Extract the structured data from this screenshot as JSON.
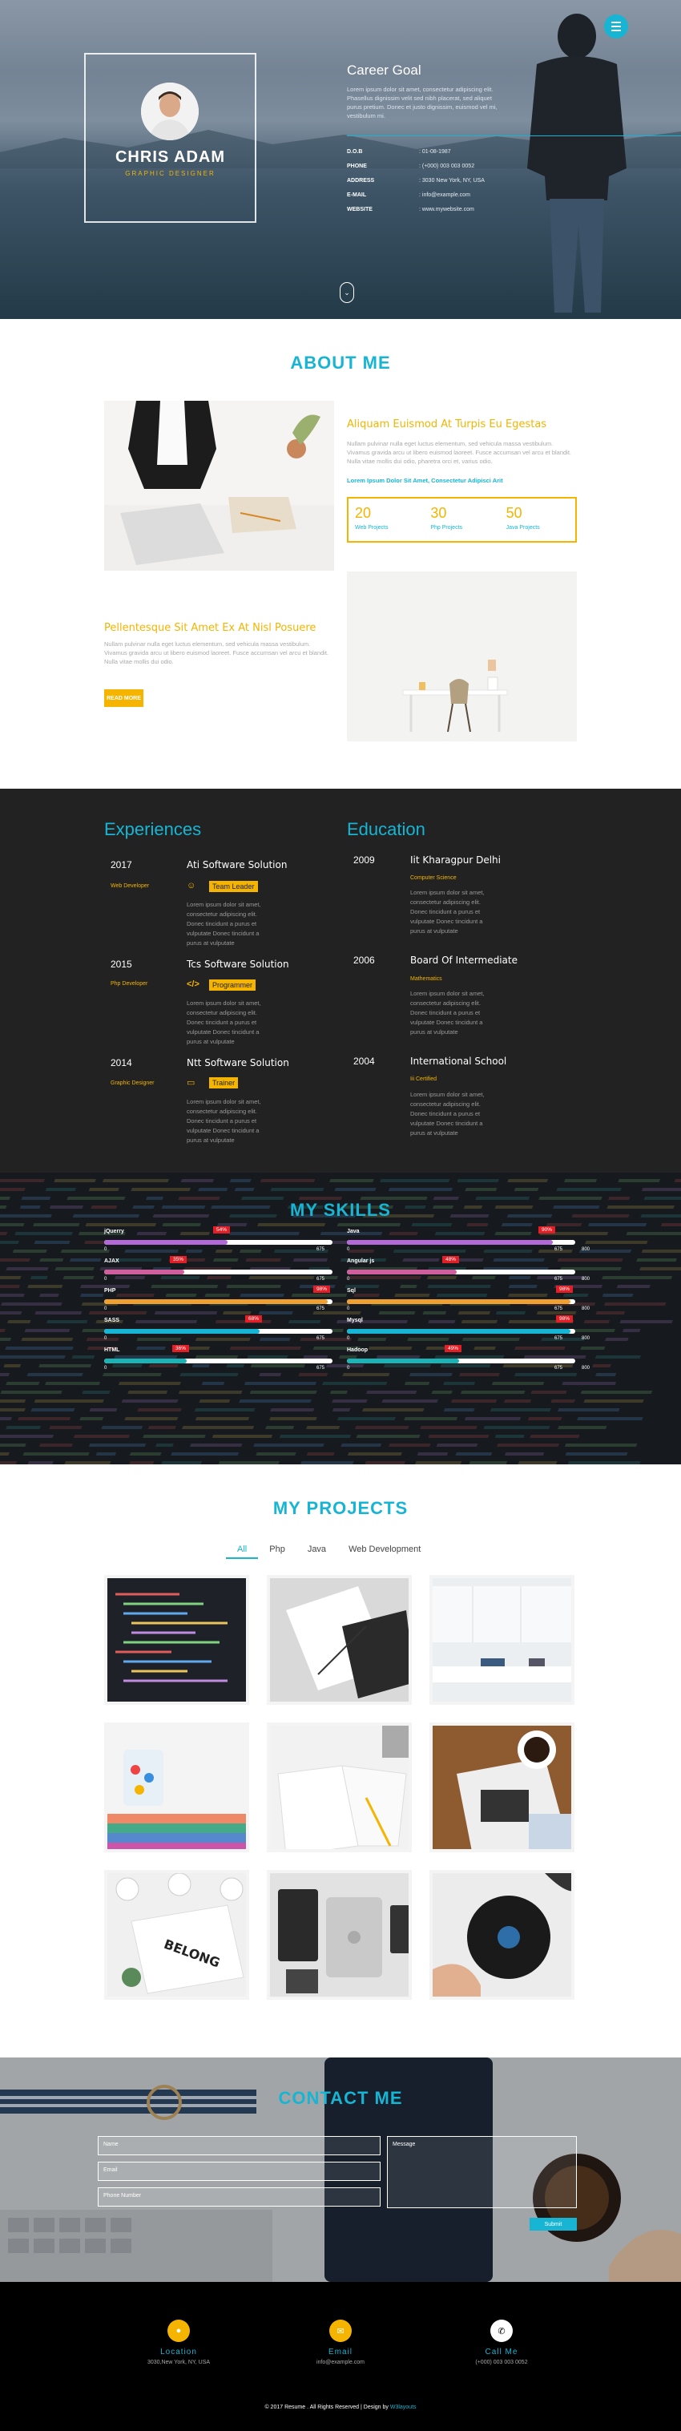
{
  "hero": {
    "name": "CHRIS ADAM",
    "role": "GRAPHIC DESIGNER",
    "goal_title": "Career Goal",
    "goal_text": "Lorem ipsum dolor sit amet, consectetur adipiscing elit. Phasellus dignissim velit sed nibh placerat, sed aliquet purus pretium. Donec et justo dignissim, euismod vel mi, vestibulum mi.",
    "info": [
      {
        "k": "D.O.B",
        "v": ": 01-08-1987"
      },
      {
        "k": "PHONE",
        "v": ": (+000) 003 003 0052"
      },
      {
        "k": "ADDRESS",
        "v": ": 3030 New York, NY, USA"
      },
      {
        "k": "E-MAIL",
        "v": ": info@example.com"
      },
      {
        "k": "WEBSITE",
        "v": ": www.mywebsite.com"
      }
    ]
  },
  "about": {
    "title": "ABOUT ME",
    "heading1": "Aliquam Euismod At Turpis Eu Egestas",
    "text1": "Nullam pulvinar nulla eget luctus elementum, sed vehicula massa vestibulum. Vivamus gravida arcu ut libero euismod laoreet. Fusce accumsan vel arcu et blandit. Nulla vitae mollis dui odio, pharetra orci et, varius odio.",
    "link1": "Lorem Ipsum Dolor Sit Amet, Consectetur Adipisci Arit",
    "stats": [
      {
        "n": "20",
        "l": "Web Projects"
      },
      {
        "n": "30",
        "l": "Php Projects"
      },
      {
        "n": "50",
        "l": "Java Projects"
      }
    ],
    "heading2": "Pellentesque Sit Amet Ex At Nisl Posuere",
    "text2": "Nullam pulvinar nulla eget luctus elementum, sed vehicula massa vestibulum. Vivamus gravida arcu ut libero euismod laoreet. Fusce accumsan vel arcu et blandit. Nulla vitae mollis dui odio.",
    "readmore": "READ MORE"
  },
  "experience": {
    "title": "Experiences",
    "items": [
      {
        "year": "2017",
        "role": "Web Developer",
        "company": "Ati Software Solution",
        "badge": "Team Leader",
        "icon": "team-icon",
        "desc": "Lorem ipsum dolor sit amet, consectetur adipiscing elit. Donec tincidunt a purus et vulputate Donec tincidunt a purus at vulputate"
      },
      {
        "year": "2015",
        "role": "Php Developer",
        "company": "Tcs Software Solution",
        "badge": "Programmer",
        "icon": "code-icon",
        "desc": "Lorem ipsum dolor sit amet, consectetur adipiscing elit. Donec tincidunt a purus et vulputate Donec tincidunt a purus at vulputate"
      },
      {
        "year": "2014",
        "role": "Graphic Designer",
        "company": "Ntt Software Solution",
        "badge": "Trainer",
        "icon": "laptop-icon",
        "desc": "Lorem ipsum dolor sit amet, consectetur adipiscing elit. Donec tincidunt a purus et vulputate Donec tincidunt a purus at vulputate"
      }
    ]
  },
  "education": {
    "title": "Education",
    "items": [
      {
        "year": "2009",
        "school": "Iit Kharagpur Delhi",
        "field": "Computer Science",
        "desc": "Lorem ipsum dolor sit amet, consectetur adipiscing elit. Donec tincidunt a purus et vulputate Donec tincidunt a purus at vulputate"
      },
      {
        "year": "2006",
        "school": "Board Of Intermediate",
        "field": "Mathematics",
        "desc": "Lorem ipsum dolor sit amet, consectetur adipiscing elit. Donec tincidunt a purus et vulputate Donec tincidunt a purus at vulputate"
      },
      {
        "year": "2004",
        "school": "International School",
        "field": "Iii Certified",
        "desc": "Lorem ipsum dolor sit amet, consectetur adipiscing elit. Donec tincidunt a purus et vulputate Donec tincidunt a purus at vulputate"
      }
    ]
  },
  "skills": {
    "title": "MY SKILLS",
    "axis_left": "0",
    "axis_mid": "675",
    "axis_right": "800",
    "left": [
      {
        "name": "jQuerry",
        "pct": "54%",
        "value": 0.54,
        "color": "#b36ad8"
      },
      {
        "name": "AJAX",
        "pct": "35%",
        "value": 0.35,
        "color": "#d05f9d"
      },
      {
        "name": "PHP",
        "pct": "98%",
        "value": 0.98,
        "color": "#f0a030"
      },
      {
        "name": "SASS",
        "pct": "68%",
        "value": 0.68,
        "color": "#17b5d3"
      },
      {
        "name": "HTML",
        "pct": "36%",
        "value": 0.36,
        "color": "#1bb3b5"
      }
    ],
    "right": [
      {
        "name": "Java",
        "pct": "90%",
        "value": 0.9,
        "color": "#b36ad8"
      },
      {
        "name": "Angular js",
        "pct": "48%",
        "value": 0.48,
        "color": "#d05f9d"
      },
      {
        "name": "Sql",
        "pct": "98%",
        "value": 0.98,
        "color": "#f0a030"
      },
      {
        "name": "Mysql",
        "pct": "98%",
        "value": 0.98,
        "color": "#17b5d3"
      },
      {
        "name": "Hadoop",
        "pct": "49%",
        "value": 0.49,
        "color": "#1bb3b5"
      }
    ]
  },
  "projects": {
    "title": "MY PROJECTS",
    "tabs": [
      "All",
      "Php",
      "Java",
      "Web Development"
    ],
    "tiles": [
      "code-screen",
      "papers",
      "office",
      "notebooks",
      "desk-notebook",
      "coffee-magazine",
      "belong-book",
      "devices",
      "record-player"
    ]
  },
  "contact": {
    "title": "CONTACT ME",
    "name_ph": "Name",
    "email_ph": "Email",
    "phone_ph": "Phone Number",
    "message_ph": "Message",
    "submit": "Submit"
  },
  "footer": {
    "location_label": "Location",
    "location_value": "3030,New York, NY, USA",
    "email_label": "Email",
    "email_value": "info@example.com",
    "call_label": "Call Me",
    "call_value": "(+000) 003 003 0052",
    "copyright": "© 2017 Resume . All Rights Reserved | Design by",
    "credit": "W3layouts"
  },
  "colors": {
    "accent": "#17b5d3",
    "highlight": "#f4b400",
    "dark": "#222222",
    "red": "#e21f26"
  }
}
